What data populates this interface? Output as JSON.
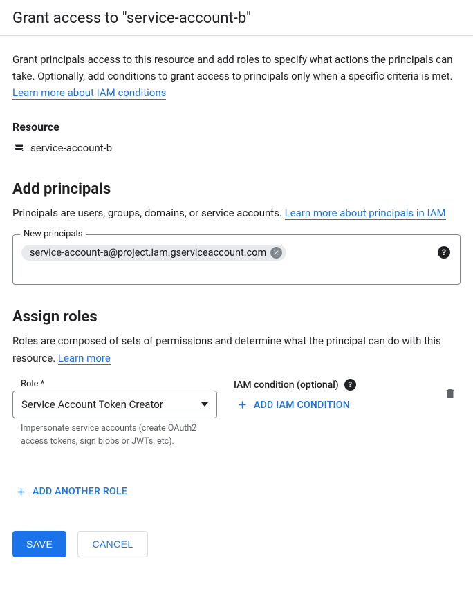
{
  "header": {
    "title": "Grant access to \"service-account-b\""
  },
  "intro": {
    "text": "Grant principals access to this resource and add roles to specify what actions the principals can take. Optionally, add conditions to grant access to principals only when a specific criteria is met. ",
    "link": "Learn more about IAM conditions"
  },
  "resource": {
    "heading": "Resource",
    "name": "service-account-b"
  },
  "principals": {
    "heading": "Add principals",
    "desc_text": "Principals are users, groups, domains, or service accounts. ",
    "desc_link": "Learn more about principals in IAM",
    "field_label": "New principals",
    "chip_value": "service-account-a@project.iam.gserviceaccount.com"
  },
  "roles": {
    "heading": "Assign roles",
    "desc_text": "Roles are composed of sets of permissions and determine what the principal can do with this resource. ",
    "desc_link": "Learn more",
    "role_label": "Role *",
    "role_value": "Service Account Token Creator",
    "role_helper": "Impersonate service accounts (create OAuth2 access tokens, sign blobs or JWTs, etc).",
    "condition_label": "IAM condition (optional)",
    "add_condition_label": "ADD IAM CONDITION",
    "add_role_label": "ADD ANOTHER ROLE"
  },
  "footer": {
    "save": "SAVE",
    "cancel": "CANCEL"
  }
}
